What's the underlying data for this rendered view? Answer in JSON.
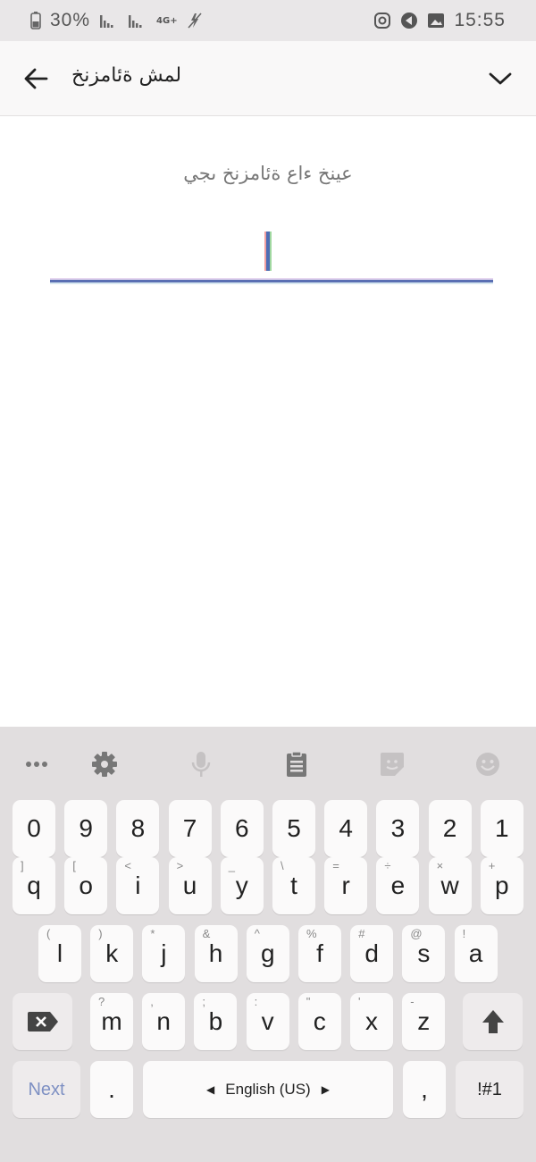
{
  "status_bar": {
    "time": "15:55",
    "battery": "30%",
    "network": "4G+"
  },
  "app_bar": {
    "title": "لمش ةئامزنخ",
    "back_icon": "arrow-left-icon",
    "collapse_icon": "chevron-down-icon"
  },
  "content": {
    "prompt": "عينخ ءاع ةئامزنخ ىجي"
  },
  "keyboard": {
    "toolbar_icons": [
      "more-icon",
      "gear-icon",
      "microphone-icon",
      "clipboard-icon",
      "sticker-icon",
      "emoji-icon"
    ],
    "row_numbers": [
      "0",
      "9",
      "8",
      "7",
      "6",
      "5",
      "4",
      "3",
      "2",
      "1"
    ],
    "row_q": [
      {
        "k": "q",
        "s": "]"
      },
      {
        "k": "o",
        "s": "["
      },
      {
        "k": "i",
        "s": "<"
      },
      {
        "k": "u",
        "s": ">"
      },
      {
        "k": "y",
        "s": "_"
      },
      {
        "k": "t",
        "s": "\\"
      },
      {
        "k": "r",
        "s": "="
      },
      {
        "k": "e",
        "s": "÷"
      },
      {
        "k": "w",
        "s": "×"
      },
      {
        "k": "p",
        "s": "+"
      }
    ],
    "row_a": [
      {
        "k": "l",
        "s": "("
      },
      {
        "k": "k",
        "s": ")"
      },
      {
        "k": "j",
        "s": "*"
      },
      {
        "k": "h",
        "s": "&"
      },
      {
        "k": "g",
        "s": "^"
      },
      {
        "k": "f",
        "s": "%"
      },
      {
        "k": "d",
        "s": "#"
      },
      {
        "k": "s",
        "s": "@"
      },
      {
        "k": "a",
        "s": "!"
      }
    ],
    "row_z": [
      {
        "k": "m",
        "s": "?"
      },
      {
        "k": "n",
        "s": ","
      },
      {
        "k": "b",
        "s": ";"
      },
      {
        "k": "v",
        "s": ":"
      },
      {
        "k": "c",
        "s": "\""
      },
      {
        "k": "x",
        "s": "'"
      },
      {
        "k": "z",
        "s": "-"
      }
    ],
    "next_label": "Next",
    "period_label": ".",
    "space_label": "English (US)",
    "comma_label": ",",
    "symbols_label": "!#1"
  }
}
